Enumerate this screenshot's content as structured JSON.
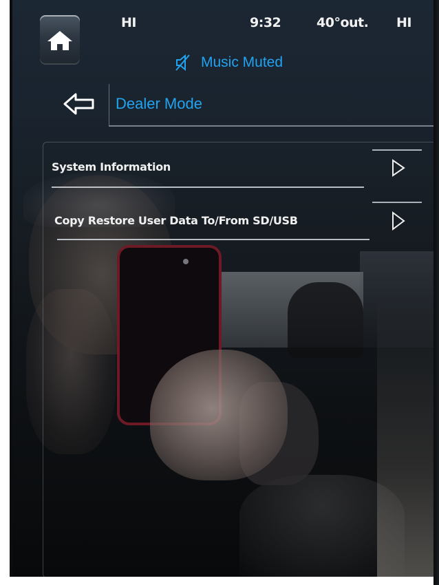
{
  "status_bar": {
    "left_temp": "HI",
    "time": "9:32",
    "outside_temp": "40°out.",
    "right_temp": "HI"
  },
  "audio_status": {
    "icon": "muted-speaker-icon",
    "text": "Music Muted"
  },
  "navigation": {
    "back_icon": "back-arrow-icon",
    "title": "Dealer Mode"
  },
  "menu": {
    "items": [
      {
        "label": "System Information",
        "icon": "chevron-right-icon"
      },
      {
        "label": "Copy Restore User Data To/From SD/USB",
        "icon": "chevron-right-icon"
      }
    ]
  },
  "colors": {
    "accent": "#22a3f0",
    "text": "#f0f0f0",
    "background": "#161c22"
  }
}
